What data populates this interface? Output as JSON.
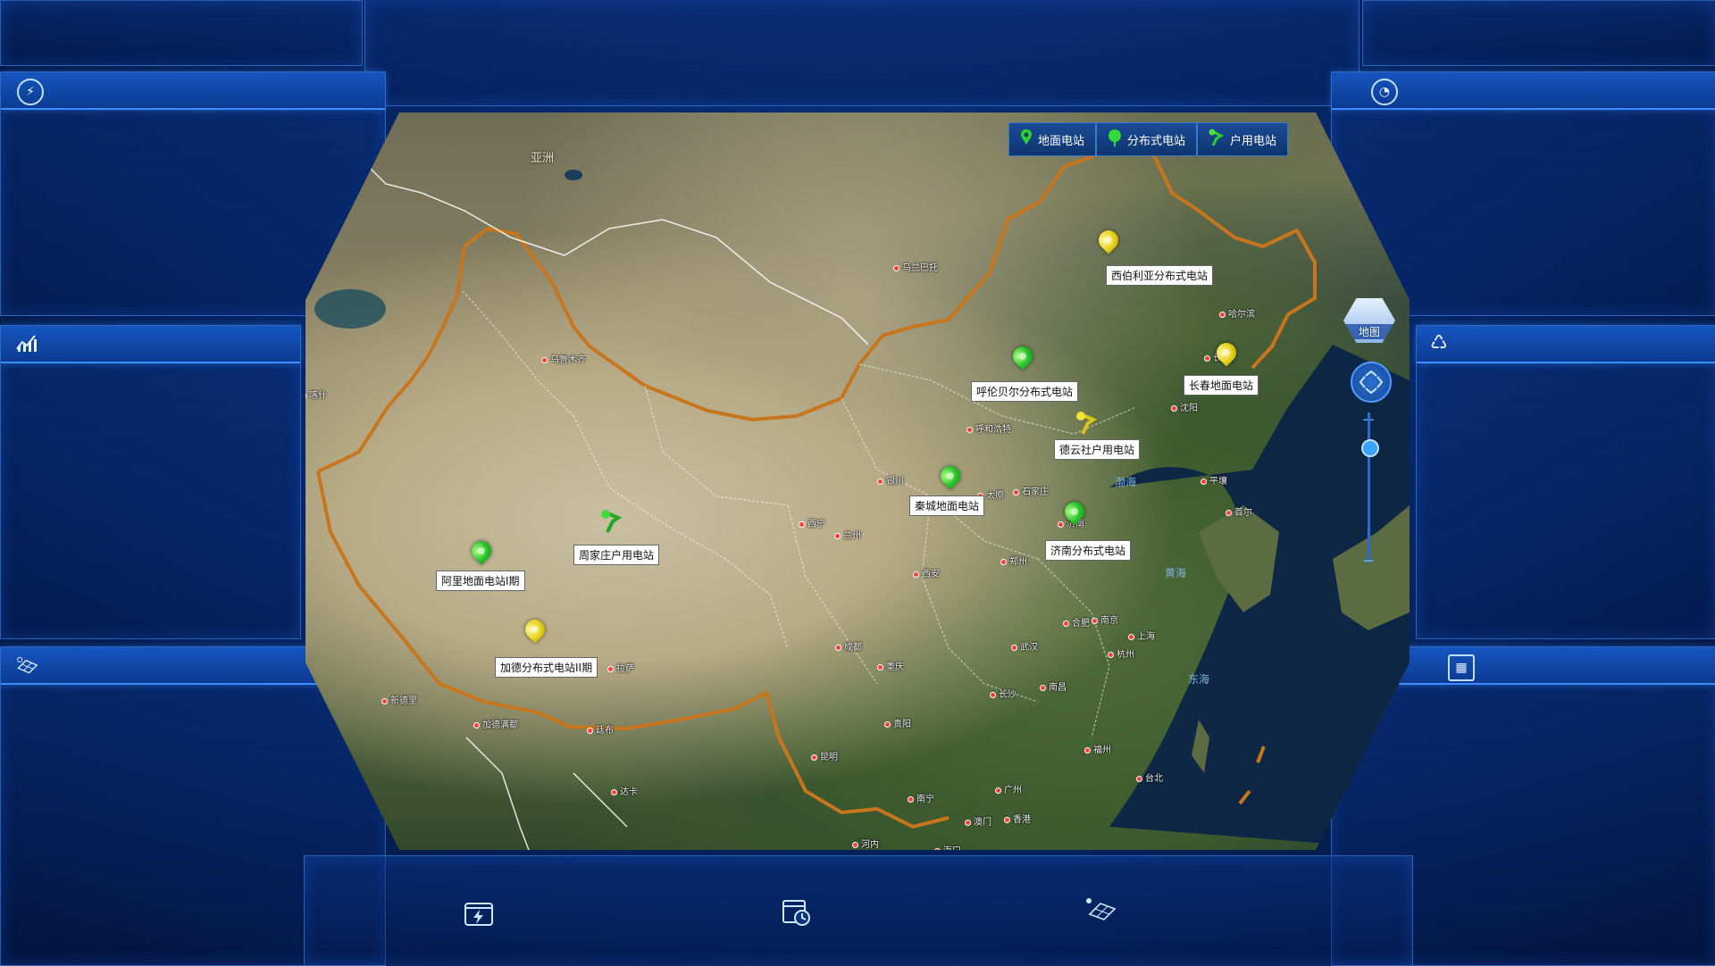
{
  "legend": [
    {
      "label": "地面电站",
      "icon": "green-pin-icon"
    },
    {
      "label": "分布式电站",
      "icon": "green-balloon-icon"
    },
    {
      "label": "户用电站",
      "icon": "green-pushpin-icon"
    }
  ],
  "map_controls": {
    "switch_label": "地图",
    "zoom_in": "+",
    "zoom_out": "−"
  },
  "regions": {
    "asia": "亚洲"
  },
  "seas": {
    "bohai": "渤海",
    "yellow_sea": "黄海",
    "east_sea": "东海"
  },
  "stations": [
    {
      "name": "西伯利亚分布式电站",
      "type": "yellow"
    },
    {
      "name": "呼伦贝尔分布式电站",
      "type": "green"
    },
    {
      "name": "长春地面电站",
      "type": "yellow"
    },
    {
      "name": "德云社户用电站",
      "type": "home-yellow"
    },
    {
      "name": "秦城地面电站",
      "type": "green"
    },
    {
      "name": "济南分布式电站",
      "type": "green"
    },
    {
      "name": "周家庄户用电站",
      "type": "home-green"
    },
    {
      "name": "阿里地面电站I期",
      "type": "green"
    },
    {
      "name": "加德分布式电站II期",
      "type": "yellow"
    }
  ],
  "cities": {
    "ulaanbaatar": "乌兰巴托",
    "urumqi": "乌鲁木齐",
    "kashgar": "喀什",
    "harbin": "哈尔滨",
    "changchun": "长春",
    "shenyang": "沈阳",
    "hohhot": "呼和浩特",
    "yinchuan": "银川",
    "taiyuan": "太原",
    "shijiazhuang": "石家庄",
    "jinan": "济南",
    "xining": "西宁",
    "lanzhou": "兰州",
    "xian": "西安",
    "zhengzhou": "郑州",
    "pyongyang": "平壤",
    "seoul": "首尔",
    "hefei": "合肥",
    "nanjing": "南京",
    "shanghai": "上海",
    "hangzhou": "杭州",
    "wuhan": "武汉",
    "chengdu": "成都",
    "chongqing": "重庆",
    "changsha": "长沙",
    "nanchang": "南昌",
    "guiyang": "贵阳",
    "kunming": "昆明",
    "fuzhou": "福州",
    "taibei": "台北",
    "nanning": "南宁",
    "guangzhou": "广州",
    "macau": "澳门",
    "hongkong": "香港",
    "haikou": "海口",
    "hanoi": "河内",
    "lhasa": "拉萨",
    "newdelhi": "新德里",
    "kathmandu": "加德满都",
    "thimphu": "廷布",
    "dhaka": "达卡"
  },
  "side_icons": {
    "left_1": "lightning-circle-icon",
    "left_2": "chart-icon",
    "left_3": "solar-panel-icon",
    "right_1": "gauge-icon",
    "right_2": "recycle-icon",
    "right_3": "calendar-icon"
  },
  "bottom_icons": [
    "lightning-box-icon",
    "calendar-clock-icon",
    "solar-array-icon"
  ]
}
